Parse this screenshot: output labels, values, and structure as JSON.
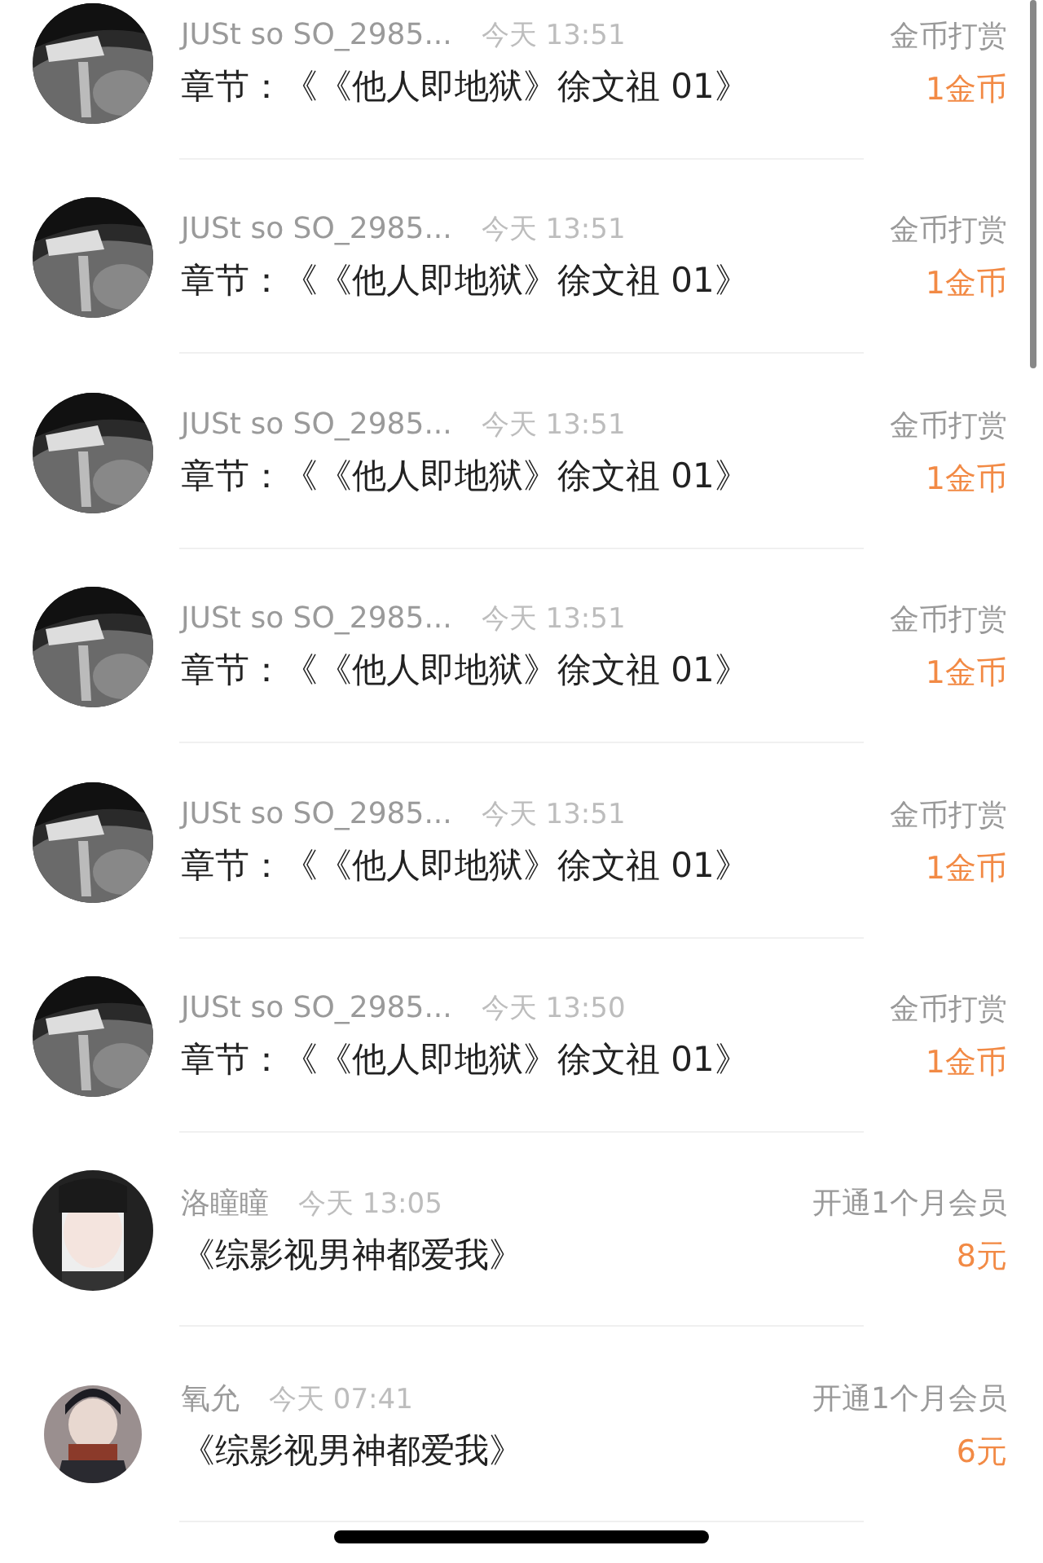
{
  "rows": [
    {
      "name": "JUSt so SO_2985...",
      "time": "今天 13:51",
      "title": "章节：《《他人即地狱》徐文祖 01》",
      "action": "金币打赏",
      "amount": "1金币"
    },
    {
      "name": "JUSt so SO_2985...",
      "time": "今天 13:51",
      "title": "章节：《《他人即地狱》徐文祖 01》",
      "action": "金币打赏",
      "amount": "1金币"
    },
    {
      "name": "JUSt so SO_2985...",
      "time": "今天 13:51",
      "title": "章节：《《他人即地狱》徐文祖 01》",
      "action": "金币打赏",
      "amount": "1金币"
    },
    {
      "name": "JUSt so SO_2985...",
      "time": "今天 13:51",
      "title": "章节：《《他人即地狱》徐文祖 01》",
      "action": "金币打赏",
      "amount": "1金币"
    },
    {
      "name": "JUSt so SO_2985...",
      "time": "今天 13:51",
      "title": "章节：《《他人即地狱》徐文祖 01》",
      "action": "金币打赏",
      "amount": "1金币"
    },
    {
      "name": "JUSt so SO_2985...",
      "time": "今天 13:50",
      "title": "章节：《《他人即地狱》徐文祖 01》",
      "action": "金币打赏",
      "amount": "1金币"
    },
    {
      "name": "洛瞳瞳",
      "time": "今天 13:05",
      "title": "《综影视男神都爱我》",
      "action": "开通1个月会员",
      "amount": "8元"
    },
    {
      "name": "氧允",
      "time": "今天 07:41",
      "title": "《综影视男神都爱我》",
      "action": "开通1个月会员",
      "amount": "6元"
    }
  ]
}
